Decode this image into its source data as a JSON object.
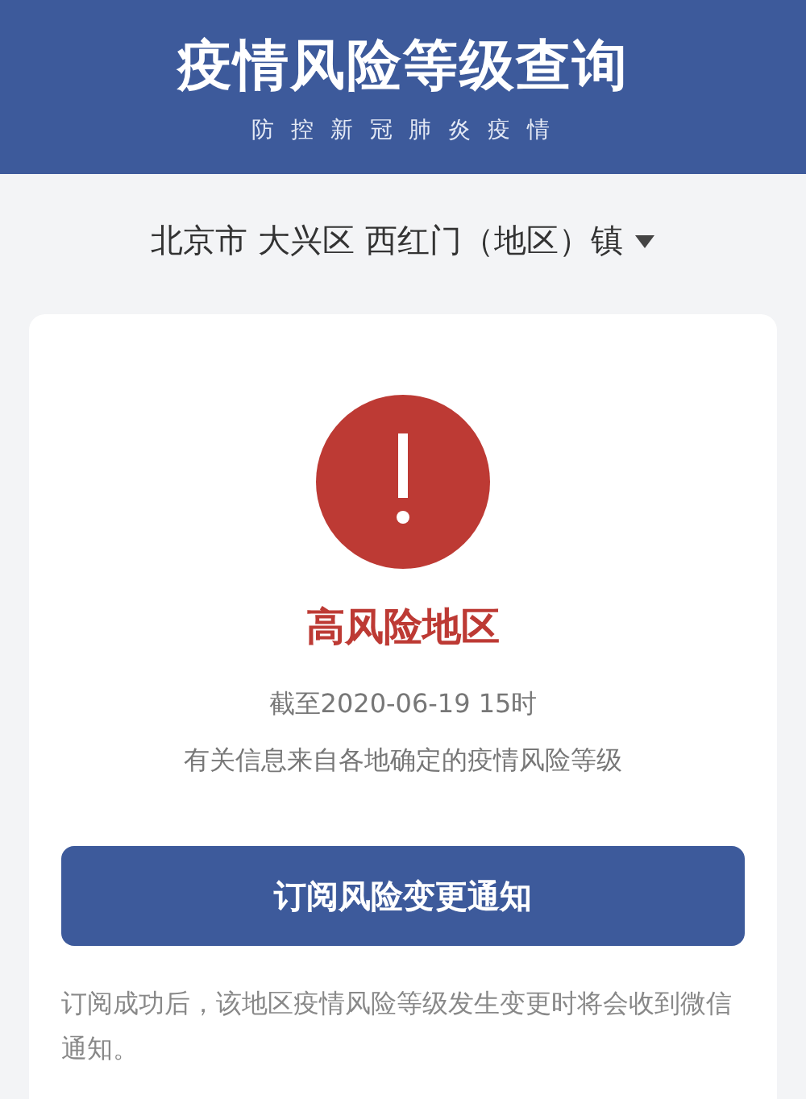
{
  "header": {
    "title": "疫情风险等级查询",
    "subtitle": "防 控 新 冠 肺 炎 疫 情"
  },
  "location": {
    "value": "北京市 大兴区 西红门（地区）镇"
  },
  "result": {
    "kind": "high",
    "label": "高风险地区",
    "updated": "截至2020-06-19 15时",
    "source": "有关信息来自各地确定的疫情风险等级"
  },
  "subscribe_button": "订阅风险变更通知",
  "note": "订阅成功后，该地区疫情风险等级发生变更时将会收到微信通知。"
}
